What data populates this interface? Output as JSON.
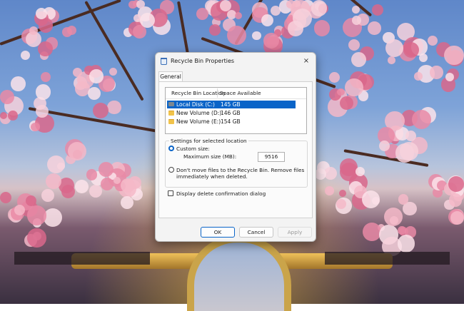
{
  "dialog": {
    "title": "Recycle Bin Properties",
    "close_icon": "×",
    "tab_label": "General"
  },
  "list": {
    "columns": [
      "Recycle Bin Location",
      "Space Available"
    ],
    "rows": [
      {
        "name": "Local Disk (C:)",
        "space": "145 GB",
        "selected": true,
        "icon": "system-drive-icon"
      },
      {
        "name": "New Volume (D:)",
        "space": "146 GB",
        "selected": false,
        "icon": "folder-drive-icon"
      },
      {
        "name": "New Volume (E:)",
        "space": "154 GB",
        "selected": false,
        "icon": "folder-drive-icon"
      }
    ]
  },
  "settings": {
    "legend": "Settings for selected location",
    "custom_size_label": "Custom size:",
    "max_size_label": "Maximum size (MB):",
    "max_size_value": "9516",
    "dont_move_label_line1": "Don't move files to the Recycle Bin. Remove files",
    "dont_move_label_line2": "immediately when deleted.",
    "custom_size_checked": true,
    "dont_move_checked": false
  },
  "confirm": {
    "label": "Display delete confirmation dialog",
    "checked": false
  },
  "buttons": {
    "ok": "OK",
    "cancel": "Cancel",
    "apply": "Apply"
  },
  "colors": {
    "accent": "#0a64c8",
    "dialog_bg": "#f3f3f3"
  }
}
